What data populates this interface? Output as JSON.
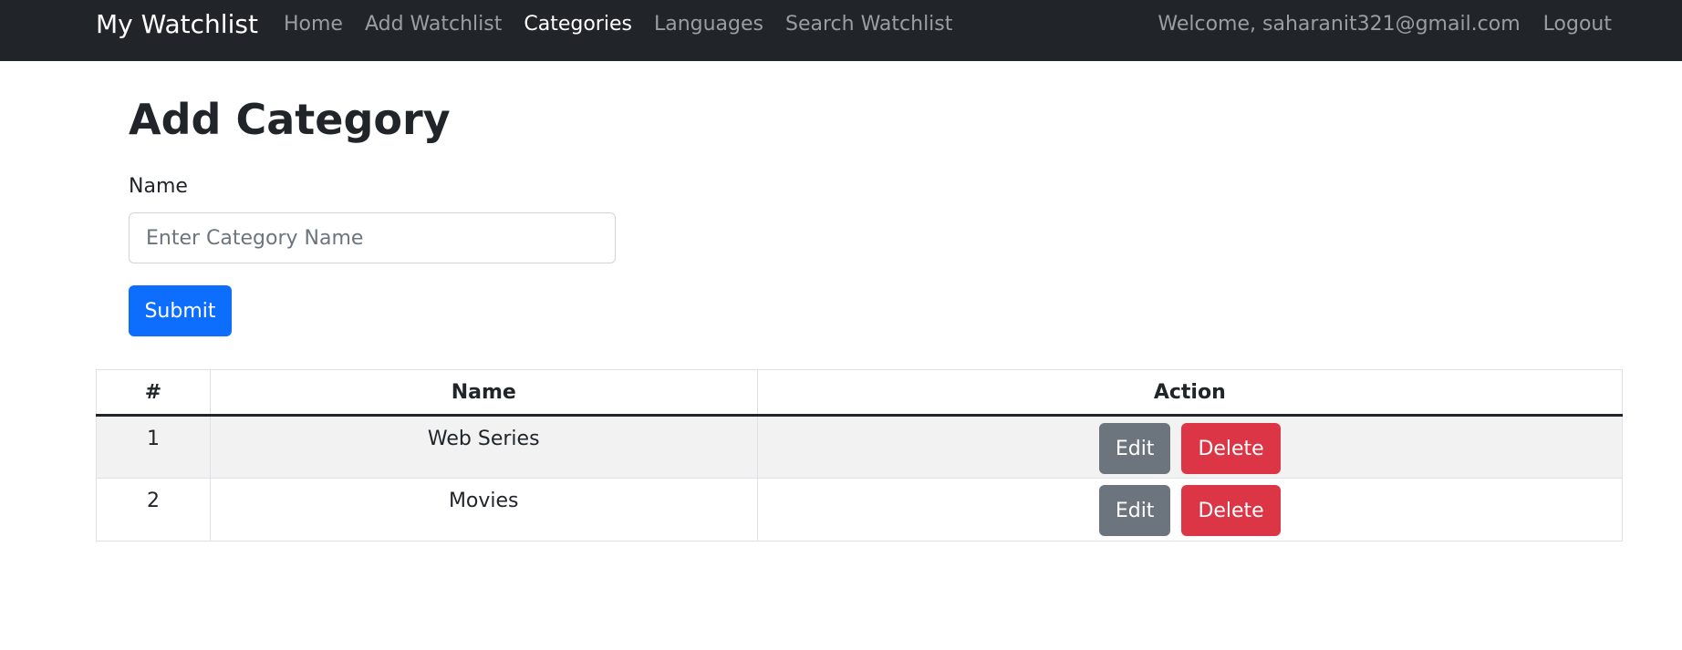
{
  "navbar": {
    "brand": "My Watchlist",
    "links": [
      "Home",
      "Add Watchlist",
      "Categories",
      "Languages",
      "Search Watchlist"
    ],
    "active_link": "Categories",
    "welcome": "Welcome, saharanit321@gmail.com",
    "logout": "Logout"
  },
  "form": {
    "title": "Add Category",
    "name_label": "Name",
    "name_value": "",
    "name_placeholder": "Enter Category Name",
    "submit_label": "Submit"
  },
  "table": {
    "headers": [
      "#",
      "Name",
      "Action"
    ],
    "rows": [
      {
        "id": "1",
        "name": "Web Series"
      },
      {
        "id": "2",
        "name": "Movies"
      }
    ],
    "edit_label": "Edit",
    "delete_label": "Delete"
  },
  "colors": {
    "navbar_bg": "#212529",
    "primary": "#0d6efd",
    "secondary": "#6c757d",
    "danger": "#dc3545"
  }
}
